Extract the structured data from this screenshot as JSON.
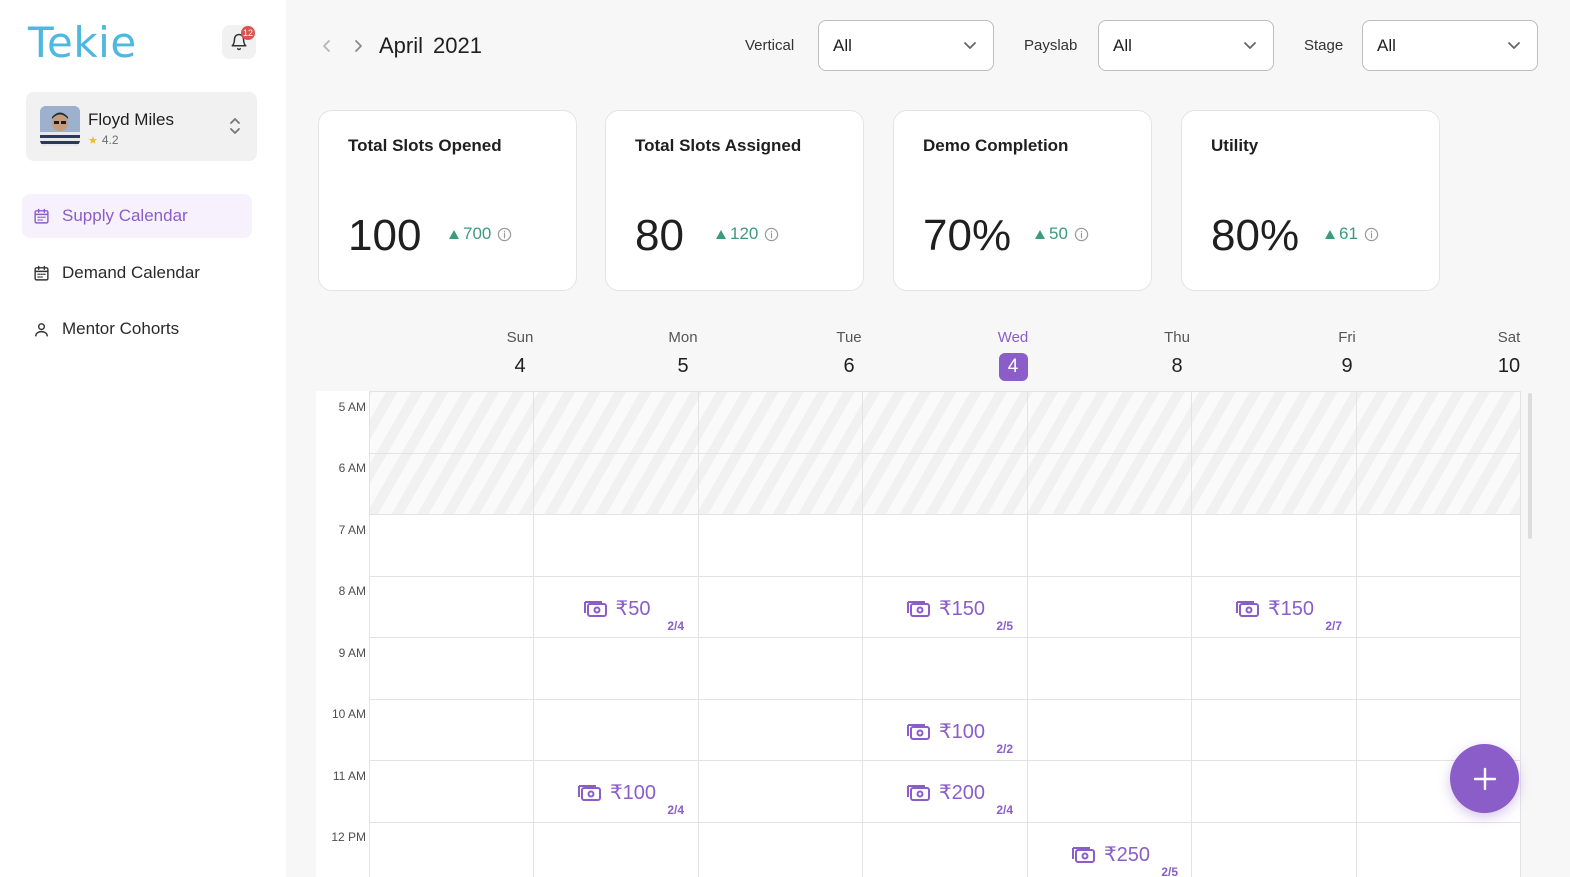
{
  "app": {
    "logo": "Tekie",
    "notification_count": "12"
  },
  "profile": {
    "name": "Floyd Miles",
    "rating": "4.2"
  },
  "nav": [
    {
      "label": "Supply Calendar",
      "icon": "calendar-icon",
      "active": true
    },
    {
      "label": "Demand Calendar",
      "icon": "calendar-icon",
      "active": false
    },
    {
      "label": "Mentor Cohorts",
      "icon": "user-icon",
      "active": false
    }
  ],
  "header": {
    "month": "April",
    "year": "2021",
    "filters": [
      {
        "label": "Vertical",
        "value": "All"
      },
      {
        "label": "Payslab",
        "value": "All"
      },
      {
        "label": "Stage",
        "value": "All"
      }
    ]
  },
  "stats": [
    {
      "title": "Total Slots Opened",
      "value": "100",
      "delta": "700"
    },
    {
      "title": "Total Slots Assigned",
      "value": "80",
      "delta": "120"
    },
    {
      "title": "Demo Completion",
      "value": "70%",
      "delta": "50"
    },
    {
      "title": "Utility",
      "value": "80%",
      "delta": "61"
    }
  ],
  "calendar": {
    "days": [
      {
        "name": "Sun",
        "num": "4"
      },
      {
        "name": "Mon",
        "num": "5"
      },
      {
        "name": "Tue",
        "num": "6"
      },
      {
        "name": "Wed",
        "num": "4",
        "today": true
      },
      {
        "name": "Thu",
        "num": "8"
      },
      {
        "name": "Fri",
        "num": "9"
      },
      {
        "name": "Sat",
        "num": "10"
      }
    ],
    "hours": [
      "5 AM",
      "6 AM",
      "7 AM",
      "8 AM",
      "9 AM",
      "10 AM",
      "11 AM",
      "12 PM"
    ],
    "slots": [
      {
        "day": 1,
        "hour": 3,
        "amount": "₹50",
        "ratio": "2/4"
      },
      {
        "day": 3,
        "hour": 3,
        "amount": "₹150",
        "ratio": "2/5"
      },
      {
        "day": 5,
        "hour": 3,
        "amount": "₹150",
        "ratio": "2/7"
      },
      {
        "day": 3,
        "hour": 5,
        "amount": "₹100",
        "ratio": "2/2"
      },
      {
        "day": 1,
        "hour": 6,
        "amount": "₹100",
        "ratio": "2/4"
      },
      {
        "day": 3,
        "hour": 6,
        "amount": "₹200",
        "ratio": "2/4"
      },
      {
        "day": 4,
        "hour": 7,
        "amount": "₹250",
        "ratio": "2/5"
      }
    ]
  },
  "colors": {
    "accent": "#8a5dc9",
    "logo": "#4fb8e0",
    "positive": "#3b9b7a",
    "badge": "#d9534f"
  }
}
